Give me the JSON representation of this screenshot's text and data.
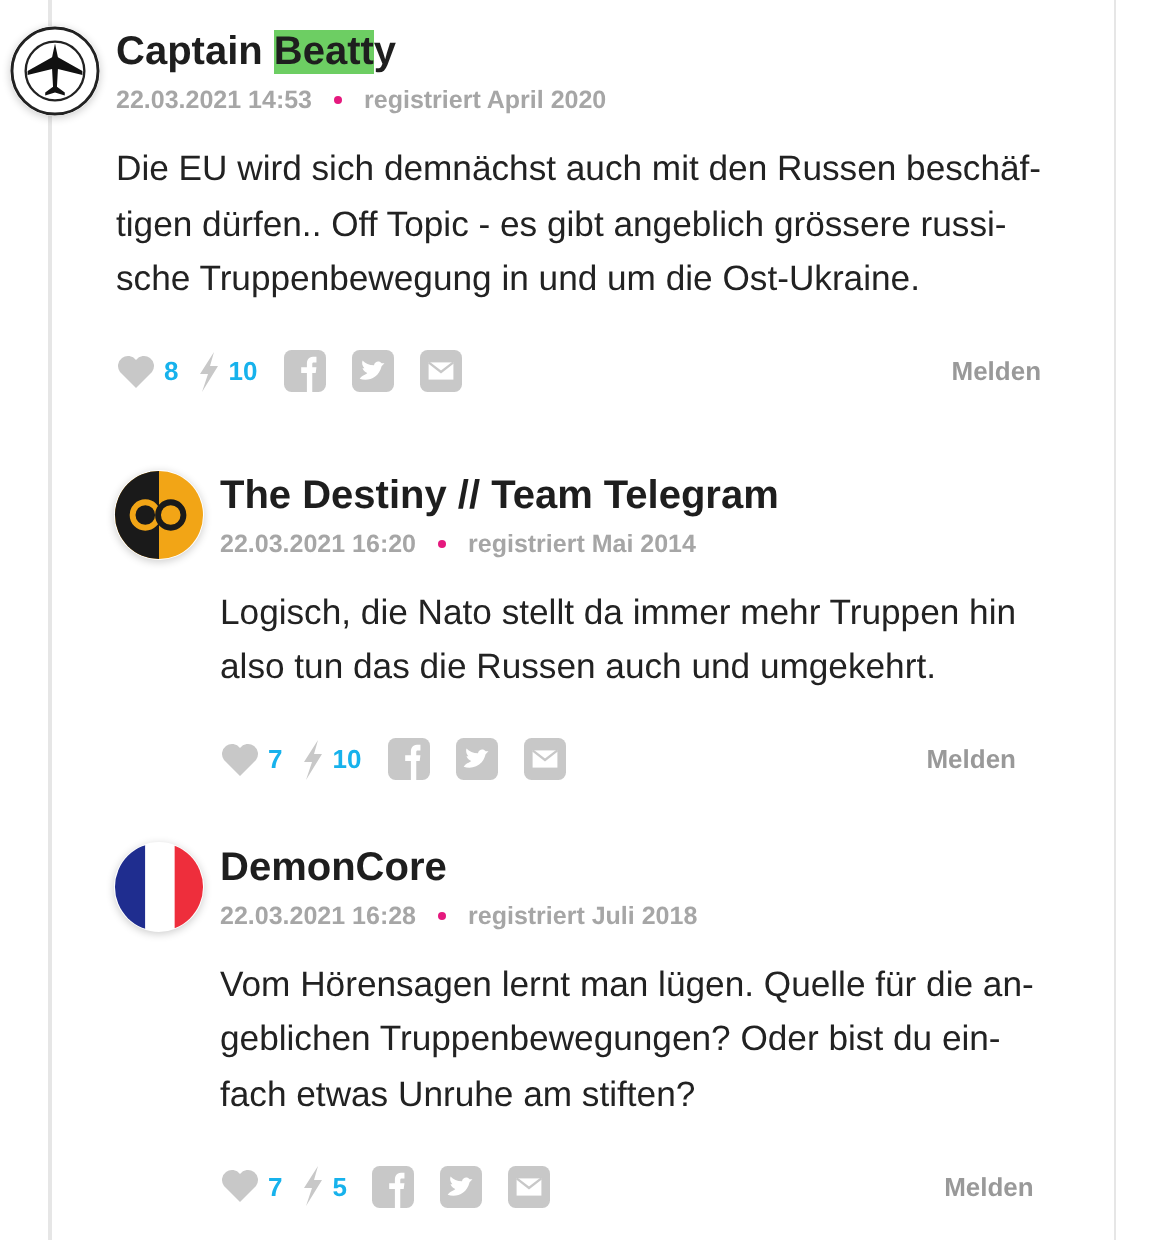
{
  "comments": [
    {
      "avatar": {
        "kind": "plane-emblem"
      },
      "name_parts": [
        {
          "text": "Captain ",
          "highlighted": false
        },
        {
          "text": "Beatt",
          "highlighted": true
        },
        {
          "text": "y",
          "highlighted": false
        }
      ],
      "date": "22.03.2021 14:53",
      "registered": "registriert April 2020",
      "lines": [
        "Die EU wird sich demnächst auch mit den Russen beschäf-",
        "tigen dürfen.. Off Topic - es gibt angeblich grössere russi-",
        "sche Truppenbewegung in und um die Ost-Ukraine."
      ],
      "likes": "8",
      "flashes": "10",
      "report": "Melden",
      "children": [
        {
          "avatar": {
            "kind": "ring-logo"
          },
          "name_parts": [
            {
              "text": "The Destiny // Team Telegram",
              "highlighted": false
            }
          ],
          "date": "22.03.2021 16:20",
          "registered": "registriert Mai 2014",
          "lines": [
            "Logisch, die Nato stellt da immer mehr Truppen hin",
            "also tun das die Russen auch und umgekehrt."
          ],
          "likes": "7",
          "flashes": "10",
          "report": "Melden"
        },
        {
          "avatar": {
            "kind": "tricolor-flag"
          },
          "name_parts": [
            {
              "text": "DemonCore",
              "highlighted": false
            }
          ],
          "date": "22.03.2021 16:28",
          "registered": "registriert Juli 2018",
          "lines": [
            "Vom Hörensagen lernt man lügen. Quelle für die an-",
            "geblichen Truppenbewegungen? Oder bist du ein-",
            "fach etwas Unruhe am stiften?"
          ],
          "likes": "7",
          "flashes": "5",
          "report": "Melden"
        }
      ]
    }
  ]
}
